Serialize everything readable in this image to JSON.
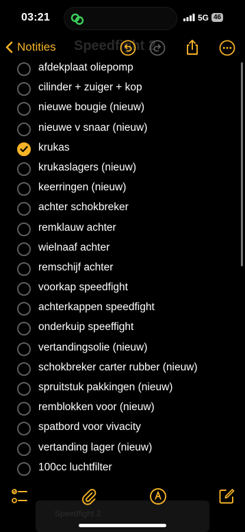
{
  "status_bar": {
    "time": "03:21",
    "network": "5G",
    "battery": "46"
  },
  "nav": {
    "back_label": "Notities",
    "ghost_title": "Speedfight 2"
  },
  "checklist": [
    {
      "text": "afdekplaat oliepomp",
      "checked": false
    },
    {
      "text": "cilinder + zuiger + kop",
      "checked": false
    },
    {
      "text": "nieuwe bougie (nieuw)",
      "checked": false
    },
    {
      "text": "nieuwe v snaar  (nieuw)",
      "checked": false
    },
    {
      "text": "krukas",
      "checked": true
    },
    {
      "text": "krukaslagers  (nieuw)",
      "checked": false
    },
    {
      "text": "keerringen (nieuw)",
      "checked": false
    },
    {
      "text": "achter schokbreker",
      "checked": false
    },
    {
      "text": "remklauw achter",
      "checked": false
    },
    {
      "text": "wielnaaf achter",
      "checked": false
    },
    {
      "text": "remschijf achter",
      "checked": false
    },
    {
      "text": "voorkap speedfight",
      "checked": false
    },
    {
      "text": "achterkappen speedfight",
      "checked": false
    },
    {
      "text": "onderkuip speeffight",
      "checked": false
    },
    {
      "text": "vertandingsolie (nieuw)",
      "checked": false
    },
    {
      "text": "schokbreker carter rubber (nieuw)",
      "checked": false
    },
    {
      "text": "spruitstuk pakkingen (nieuw)",
      "checked": false
    },
    {
      "text": "remblokken voor (nieuw)",
      "checked": false
    },
    {
      "text": "spatbord voor  vivacity",
      "checked": false
    },
    {
      "text": "vertanding lager (nieuw)",
      "checked": false
    },
    {
      "text": "100cc luchtfilter",
      "checked": false
    }
  ],
  "ghost_bottom_text": "Speedfight 2",
  "colors": {
    "accent": "#f5b327",
    "background": "#000000",
    "unchecked": "#5d5d5f"
  },
  "icons": {
    "nav": [
      "chevron-left-icon",
      "undo-icon",
      "redo-icon",
      "share-icon",
      "more-icon"
    ],
    "toolbar": [
      "checklist-icon",
      "paperclip-icon",
      "markup-pen-icon",
      "compose-icon"
    ]
  }
}
